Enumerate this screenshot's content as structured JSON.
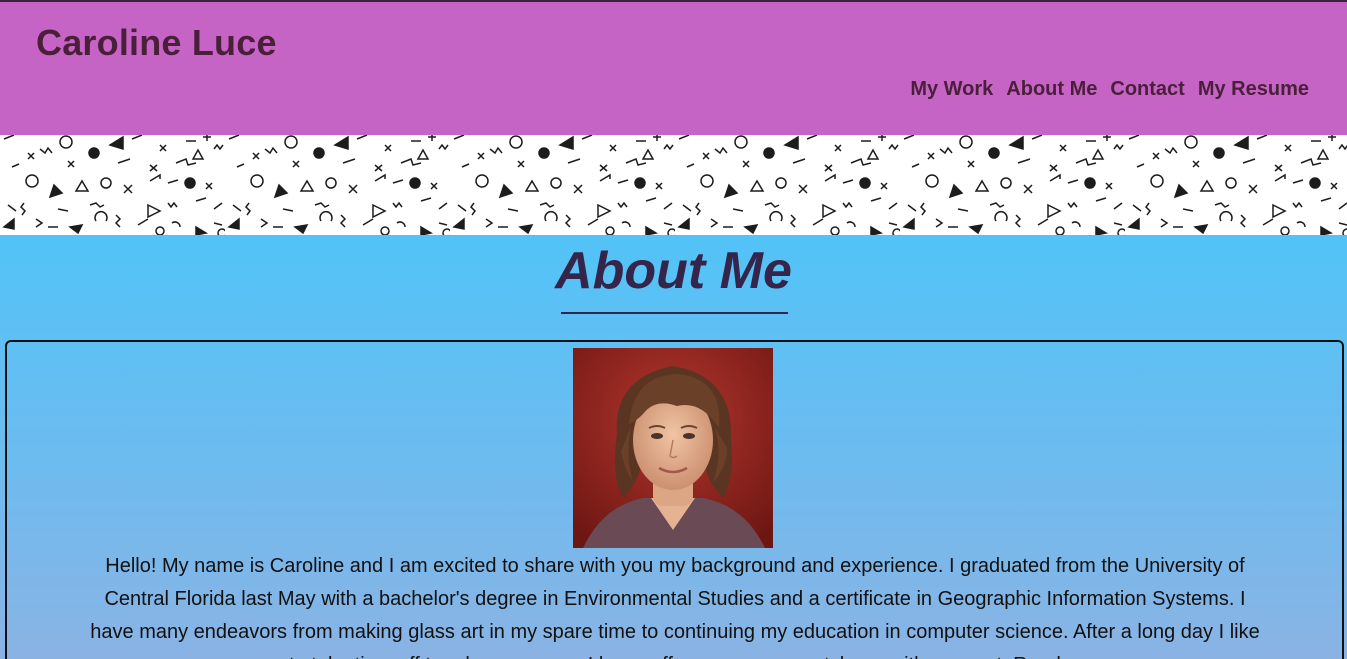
{
  "header": {
    "site_title": "Caroline Luce",
    "nav": [
      {
        "label": "My Work"
      },
      {
        "label": "About Me"
      },
      {
        "label": "Contact"
      },
      {
        "label": "My Resume"
      }
    ]
  },
  "about": {
    "heading": "About Me",
    "bio": "Hello! My name is Caroline and I am excited to share with you my background and experience. I graduated from the University of Central Florida last May with a bachelor's degree in Environmental Studies and a certificate in Geographic Information Systems. I have many endeavors from making glass art in my spare time to continuing my education in computer science. After a long day I like to take time off to relax or go run. I love coffee so you can catch me with some at. Read"
  },
  "colors": {
    "header_bg": "#c664c6",
    "header_text": "#4a1f3a",
    "content_bg": "#52c3f7",
    "heading_text": "#36254a"
  },
  "icons": {
    "pattern": "memphis-geometric-pattern",
    "portrait": "profile-photo"
  }
}
